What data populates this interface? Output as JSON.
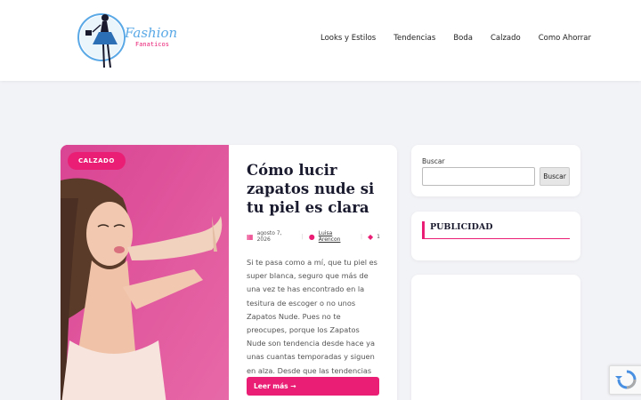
{
  "brand": {
    "name_line1": "Fashion",
    "name_line2": "Fanaticos",
    "accent": "#e91e74"
  },
  "nav": {
    "items": [
      "Looks y Estilos",
      "Tendencias",
      "Boda",
      "Calzado",
      "Como Ahorrar"
    ]
  },
  "article": {
    "category": "CALZADO",
    "title": "Cómo lucir zapatos nude si tu piel es clara",
    "date": "agosto 7, 2026",
    "author": "Luisa Arencon",
    "comments": "1",
    "excerpt": "Si te pasa como a mí, que tu piel es super blanca, seguro que más de una vez te has encontrado en la tesitura de escoger o no unos Zapatos Nude. Pues no te preocupes, porque los Zapatos Nude son tendencia desde hace ya unas cuantas temporadas y siguen en alza. Desde que las tendencias […]",
    "read_more": "Leer más →"
  },
  "sidebar": {
    "search_label": "Buscar",
    "search_button": "Buscar",
    "search_placeholder": "",
    "publicidad_title": "PUBLICIDAD"
  }
}
